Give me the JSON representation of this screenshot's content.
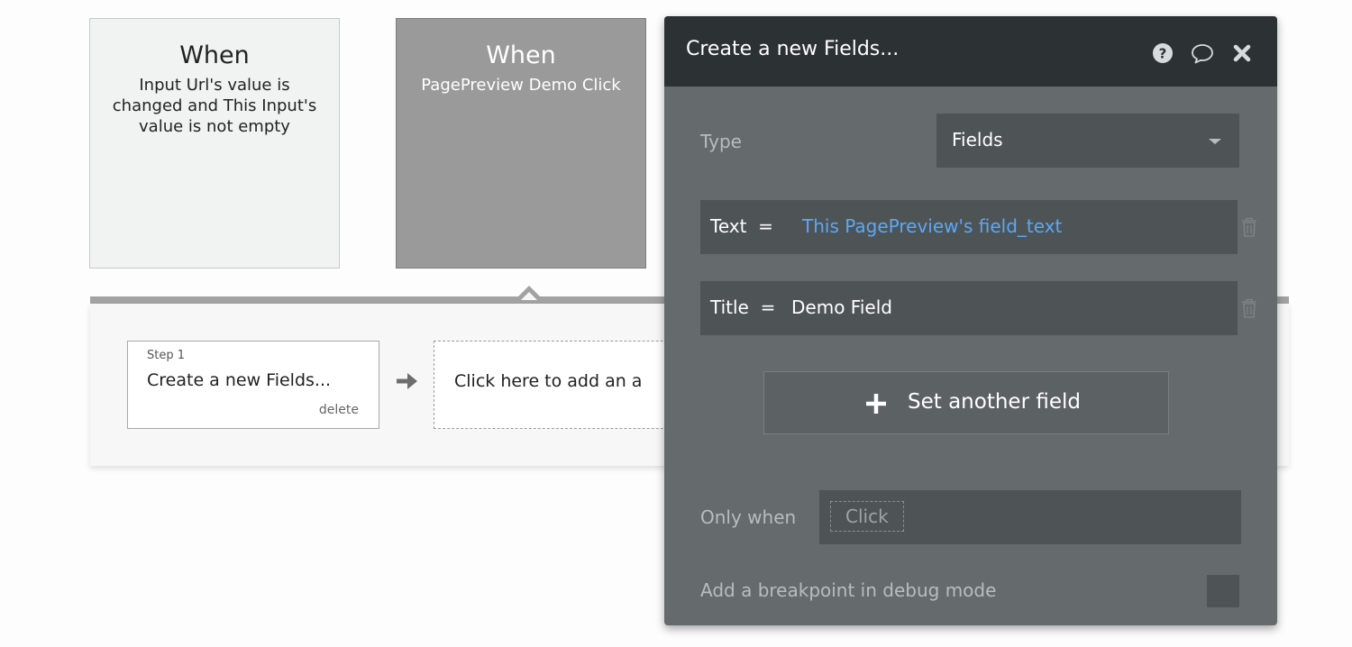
{
  "events": [
    {
      "when_label": "When",
      "condition": "Input Url's value is changed and This Input's value is not empty"
    },
    {
      "when_label": "When",
      "condition": "PagePreview Demo Click"
    }
  ],
  "workflow": {
    "step": {
      "label": "Step 1",
      "title": "Create a new Fields...",
      "delete_label": "delete"
    },
    "add_action_label": "Click here to add an a"
  },
  "panel": {
    "title": "Create a new Fields...",
    "type_label": "Type",
    "type_value": "Fields",
    "fields": [
      {
        "key": "Text",
        "operator": "=",
        "value": "This PagePreview's field_text",
        "value_color": "#5ba8f5"
      },
      {
        "key": "Title",
        "operator": "=",
        "value": "Demo Field",
        "value_color": "#ffffff"
      }
    ],
    "set_another_field_label": "Set another field",
    "only_when_label": "Only when",
    "only_when_placeholder": "Click",
    "breakpoint_label": "Add a breakpoint in debug mode",
    "icons": [
      "help-icon",
      "comment-icon",
      "close-icon"
    ]
  },
  "colors": {
    "panel_bg": "#656a6c",
    "header_bg": "#2c3234",
    "field_bg": "#4e5456",
    "link_blue": "#5ba8f5"
  }
}
